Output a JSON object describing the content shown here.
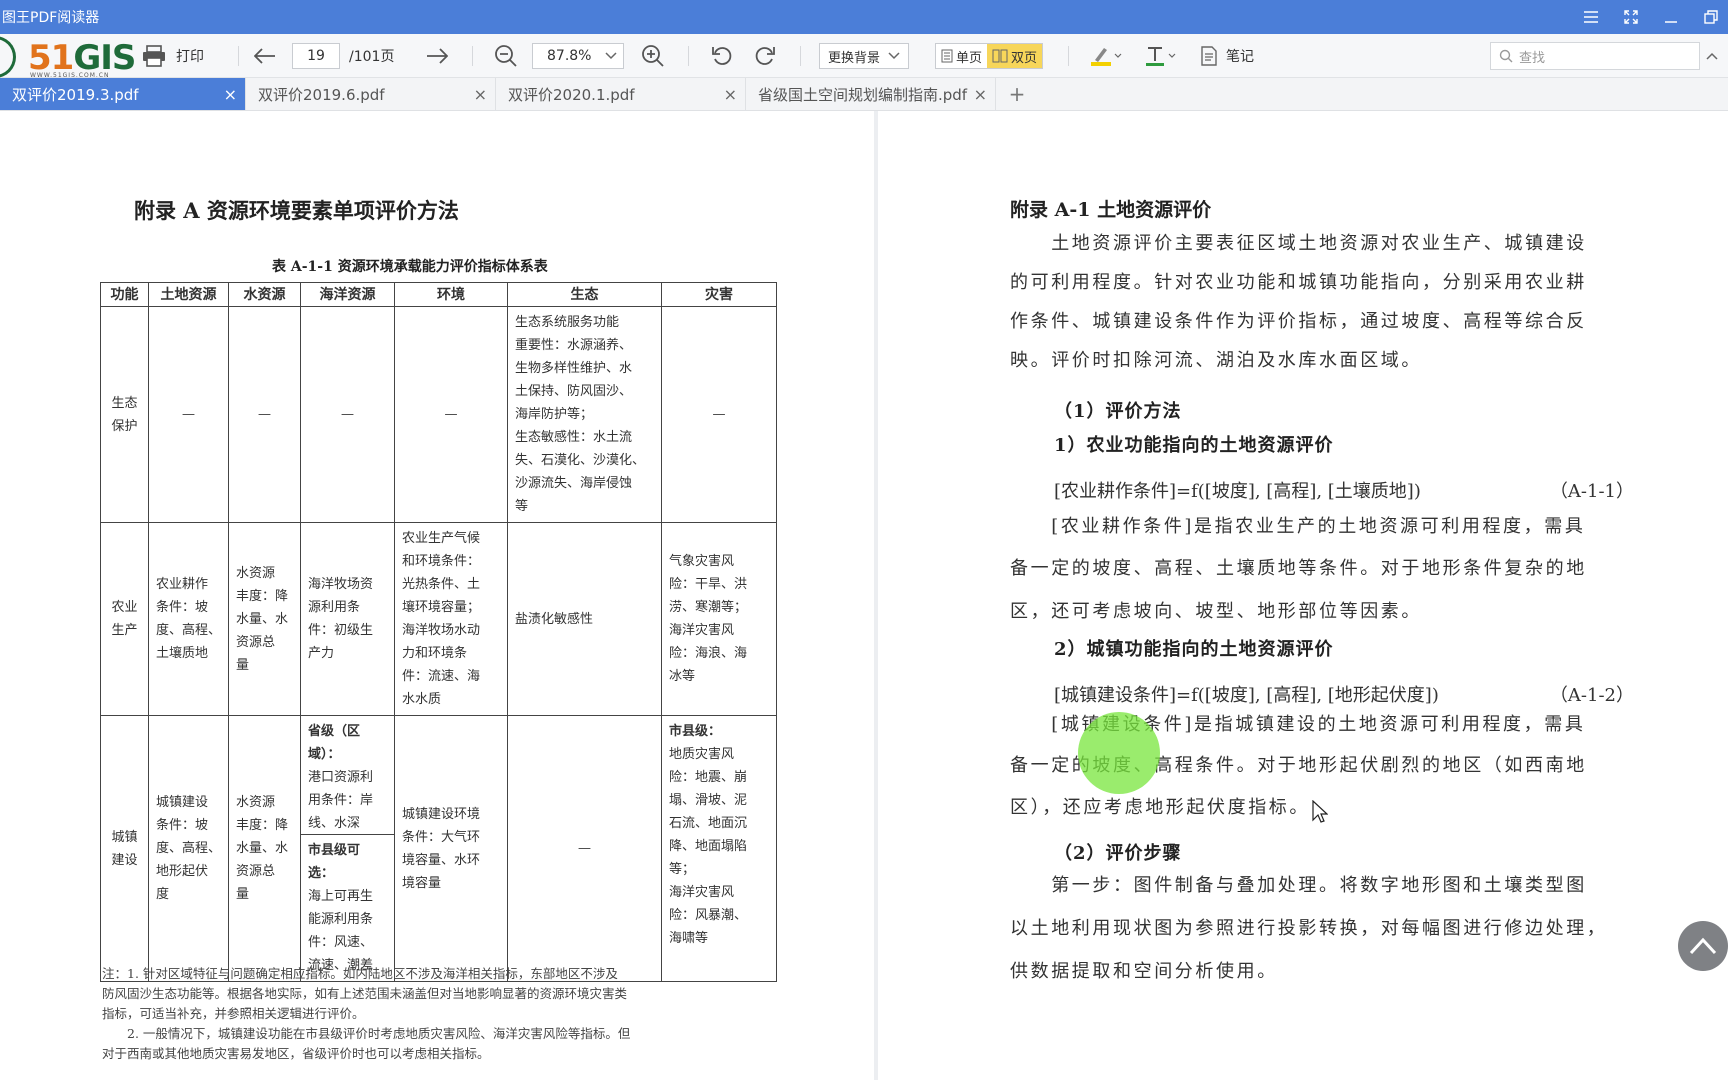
{
  "window": {
    "title": "图王PDF阅读器"
  },
  "toolbar": {
    "logo_text_five": "51",
    "logo_text_gis": "GIS",
    "logo_sub": "WWW.51GIS.COM.CN",
    "print_label": "打印",
    "current_page": "19",
    "total_pages": "/101页",
    "zoom_value": "87.8%",
    "background_label": "更换背景",
    "single_page_label": "单页",
    "double_page_label": "双页",
    "note_label": "笔记",
    "search_placeholder": "查找"
  },
  "tabs": [
    {
      "label": "双评价2019.3.pdf",
      "active": true
    },
    {
      "label": "双评价2019.6.pdf",
      "active": false
    },
    {
      "label": "双评价2020.1.pdf",
      "active": false
    },
    {
      "label": "省级国土空间规划编制指南.pdf",
      "active": false
    }
  ],
  "left_page": {
    "heading": "附录 A 资源环境要素单项评价方法",
    "table_title": "表 A-1-1 资源环境承载能力评价指标体系表",
    "table": {
      "headers": [
        "功能",
        "土地资源",
        "水资源",
        "海洋资源",
        "环境",
        "生态",
        "灾害"
      ],
      "rows": [
        {
          "function": "生态\n保护",
          "land": "—",
          "water": "—",
          "ocean": "—",
          "environment": "—",
          "ecology": "生态系统服务功能\n重要性：水源涵养、\n生物多样性维护、水\n土保持、防风固沙、\n海岸防护等；\n生态敏感性：水土流\n失、石漠化、沙漠化、\n沙源流失、海岸侵蚀\n等",
          "disaster": "—"
        },
        {
          "function": "农业\n生产",
          "land": "农业耕作\n条件：坡\n度、高程、\n土壤质地",
          "water": "水资源\n丰度：降\n水量、水\n资源总\n量",
          "ocean": "海洋牧场资\n源利用条\n件：初级生\n产力",
          "environment": "农业生产气候\n和环境条件：\n光热条件、土\n壤环境容量；\n海洋牧场水动\n力和环境条\n件：流速、海\n水水质",
          "ecology": "盐渍化敏感性",
          "disaster": "气象灾害风\n险：干旱、洪\n涝、寒潮等；\n海洋灾害风\n险：海浪、海\n冰等"
        },
        {
          "function": "城镇\n建设",
          "land": "城镇建设\n条件：坡\n度、高程、\n地形起伏\n度",
          "water": "水资源\n丰度：降\n水量、水\n资源总\n量",
          "ocean_part1_title": "省级（区\n域）：",
          "ocean_part1_body": "港口资源利\n用条件：岸\n线、水深",
          "ocean_part2_title": "市县级可\n选：",
          "ocean_part2_body": "海上可再生\n能源利用条\n件：风速、\n流速、潮差",
          "environment": "城镇建设环境\n条件：大气环\n境容量、水环\n境容量",
          "ecology": "—",
          "disaster_title": "市县级：",
          "disaster_body": "地质灾害风\n险：地震、崩\n塌、滑坡、泥\n石流、地面沉\n降、地面塌陷\n等；\n海洋灾害风\n险：风暴潮、\n海啸等"
        }
      ]
    },
    "notes": [
      "注：1. 针对区域特征与问题确定相应指标。如内陆地区不涉及海洋相关指标，东部地区不涉及",
      "防风固沙生态功能等。根据各地实际，如有上述范围未涵盖但对当地影响显著的资源环境灾害类",
      "指标，可适当补充，并参照相关逻辑进行评价。",
      "　　2. 一般情况下，城镇建设功能在市县级评价时考虑地质灾害风险、海洋灾害风险等指标。但",
      "对于西南或其他地质灾害易发地区，省级评价时也可以考虑相关指标。"
    ]
  },
  "right_page": {
    "heading": "附录 A-1 土地资源评价",
    "intro_lines": [
      "　　土地资源评价主要表征区域土地资源对农业生产、城镇建设",
      "的可利用程度。针对农业功能和城镇功能指向，分别采用农业耕",
      "作条件、城镇建设条件作为评价指标，通过坡度、高程等综合反",
      "映。评价时扣除河流、湖泊及水库水面区域。"
    ],
    "method_heading": "（1）评价方法",
    "sub1_heading": "1）农业功能指向的土地资源评价",
    "formula1": "[农业耕作条件]=f([坡度], [高程], [土壤质地])",
    "formula1_num": "（A-1-1）",
    "sub1_lines": [
      "　　[农业耕作条件]是指农业生产的土地资源可利用程度，需具",
      "备一定的坡度、高程、土壤质地等条件。对于地形条件复杂的地",
      "区，还可考虑坡向、坡型、地形部位等因素。"
    ],
    "sub2_heading": "2）城镇功能指向的土地资源评价",
    "formula2": "[城镇建设条件]=f([坡度], [高程], [地形起伏度])",
    "formula2_num": "（A-1-2）",
    "sub2_lines": [
      "　　[城镇建设条件]是指城镇建设的土地资源可利用程度，需具",
      "备一定的坡度、高程条件。对于地形起伏剧烈的地区（如西南地",
      "区），还应考虑地形起伏度指标。"
    ],
    "steps_heading": "（2）评价步骤",
    "step_lines": [
      "　　第一步：图件制备与叠加处理。将数字地形图和土壤类型图",
      "以土地利用现状图为参照进行投影转换，对每幅图进行修边处理，",
      "供数据提取和空间分析使用。"
    ]
  },
  "colors": {
    "titlebar": "#4b7ed8",
    "active_tab": "#4b7ed8",
    "toggle_on": "#f7d65a",
    "highlight": "#78e63c"
  }
}
